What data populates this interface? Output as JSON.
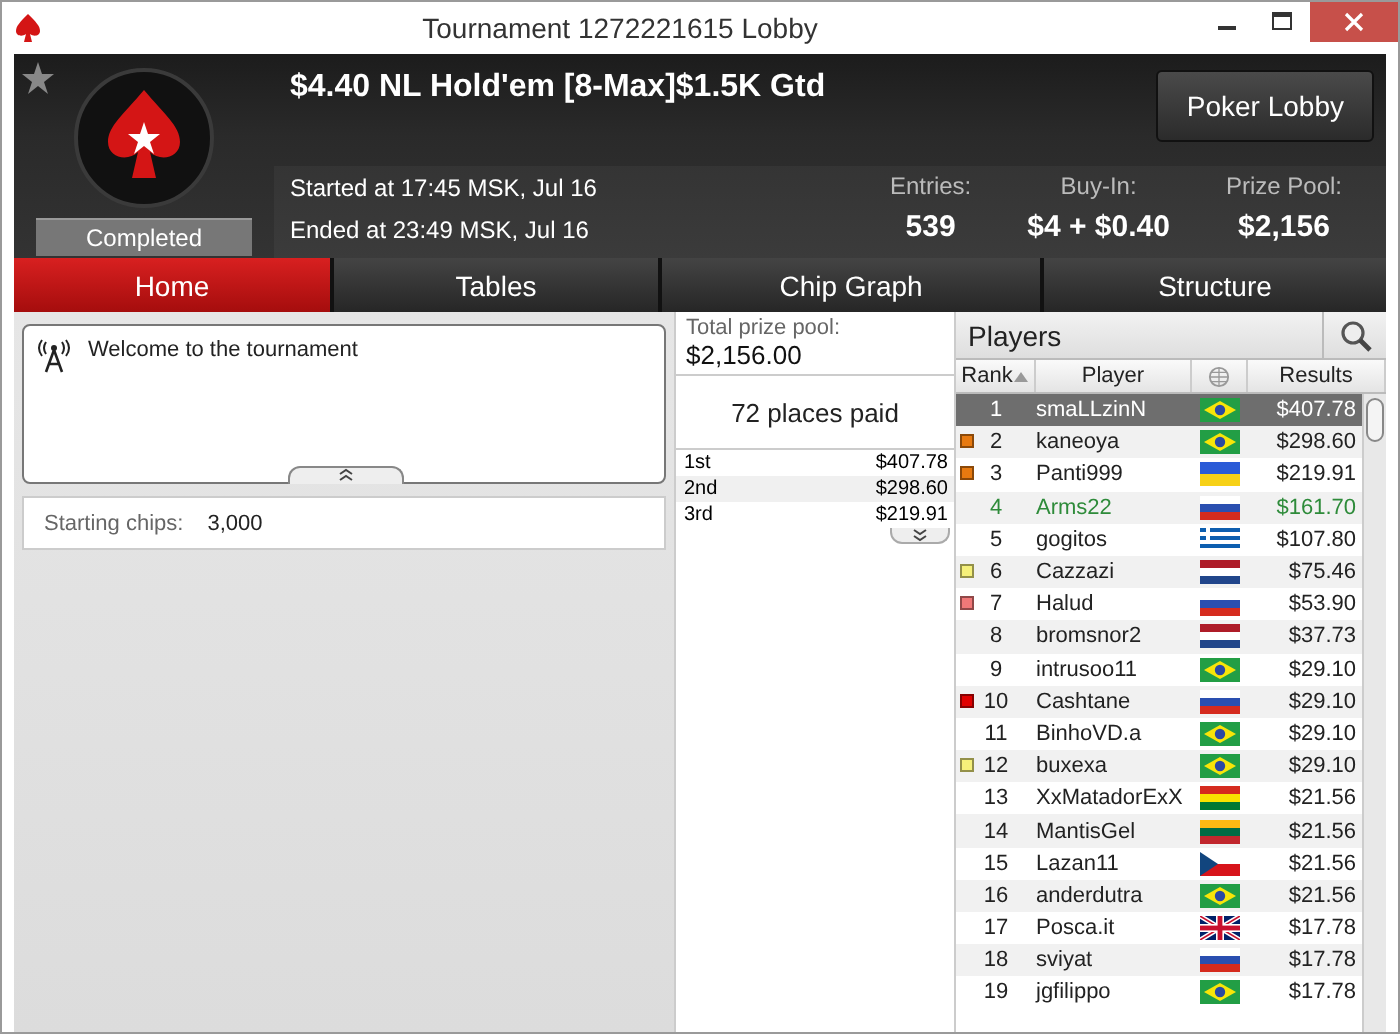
{
  "window": {
    "title": "Tournament 1272221615 Lobby"
  },
  "header": {
    "tournament_name": "$4.40 NL Hold'em [8-Max]$1.5K Gtd",
    "status": "Completed",
    "started": "Started at 17:45 MSK, Jul 16",
    "ended": "Ended at 23:49 MSK, Jul 16",
    "lobby_button": "Poker Lobby",
    "stats": [
      {
        "label": "Entries:",
        "value": "539"
      },
      {
        "label": "Buy-In:",
        "value": "$4 + $0.40"
      },
      {
        "label": "Prize Pool:",
        "value": "$2,156"
      }
    ]
  },
  "tabs": [
    {
      "label": "Home",
      "selected": true
    },
    {
      "label": "Tables",
      "selected": false
    },
    {
      "label": "Chip Graph",
      "selected": false
    },
    {
      "label": "Structure",
      "selected": false
    }
  ],
  "news": {
    "message": "Welcome to the tournament"
  },
  "info": {
    "label": "Starting chips:",
    "value": "3,000"
  },
  "prizes": {
    "total_label": "Total prize pool:",
    "total": "$2,156.00",
    "places": "72 places paid",
    "rows": [
      {
        "place": "1st",
        "amount": "$407.78"
      },
      {
        "place": "2nd",
        "amount": "$298.60"
      },
      {
        "place": "3rd",
        "amount": "$219.91"
      }
    ]
  },
  "players": {
    "title": "Players",
    "columns": [
      "Rank",
      "Player",
      "Results"
    ],
    "rows": [
      {
        "rank": "1",
        "name": "smaLLzinN",
        "flag": {
          "kind": "br"
        },
        "result": "$407.78",
        "selected": true,
        "highlighted": false
      },
      {
        "rank": "2",
        "name": "kaneoya",
        "flag": {
          "kind": "br"
        },
        "result": "$298.60",
        "selected": false,
        "highlighted": false,
        "color": "#e87a10"
      },
      {
        "rank": "3",
        "name": "Panti999",
        "flag": {
          "kind": "ua"
        },
        "result": "$219.91",
        "selected": false,
        "highlighted": false,
        "color": "#e87a10"
      },
      {
        "rank": "4",
        "name": "Arms22",
        "flag": {
          "kind": "ru"
        },
        "result": "$161.70",
        "selected": false,
        "highlighted": true
      },
      {
        "rank": "5",
        "name": "gogitos",
        "flag": {
          "kind": "gr"
        },
        "result": "$107.80",
        "selected": false,
        "highlighted": false
      },
      {
        "rank": "6",
        "name": "Cazzazi",
        "flag": {
          "kind": "nl"
        },
        "result": "$75.46",
        "selected": false,
        "highlighted": false,
        "color": "#f5f07a"
      },
      {
        "rank": "7",
        "name": "Halud",
        "flag": {
          "kind": "ru"
        },
        "result": "$53.90",
        "selected": false,
        "highlighted": false,
        "color": "#f07878"
      },
      {
        "rank": "8",
        "name": "bromsnor2",
        "flag": {
          "kind": "nl"
        },
        "result": "$37.73",
        "selected": false,
        "highlighted": false
      },
      {
        "rank": "9",
        "name": "intrusoo11",
        "flag": {
          "kind": "br"
        },
        "result": "$29.10",
        "selected": false,
        "highlighted": false
      },
      {
        "rank": "10",
        "name": "Cashtane",
        "flag": {
          "kind": "ru"
        },
        "result": "$29.10",
        "selected": false,
        "highlighted": false,
        "color": "#e00000"
      },
      {
        "rank": "11",
        "name": "BinhoVD.a",
        "flag": {
          "kind": "br"
        },
        "result": "$29.10",
        "selected": false,
        "highlighted": false
      },
      {
        "rank": "12",
        "name": "buxexa",
        "flag": {
          "kind": "br"
        },
        "result": "$29.10",
        "selected": false,
        "highlighted": false,
        "color": "#f5f07a"
      },
      {
        "rank": "13",
        "name": "XxMatadorExX",
        "flag": {
          "kind": "bo"
        },
        "result": "$21.56",
        "selected": false,
        "highlighted": false
      },
      {
        "rank": "14",
        "name": "MantisGel",
        "flag": {
          "kind": "lt"
        },
        "result": "$21.56",
        "selected": false,
        "highlighted": false
      },
      {
        "rank": "15",
        "name": "Lazan11",
        "flag": {
          "kind": "cz"
        },
        "result": "$21.56",
        "selected": false,
        "highlighted": false
      },
      {
        "rank": "16",
        "name": "anderdutra",
        "flag": {
          "kind": "br"
        },
        "result": "$21.56",
        "selected": false,
        "highlighted": false
      },
      {
        "rank": "17",
        "name": "Posca.it",
        "flag": {
          "kind": "gb"
        },
        "result": "$17.78",
        "selected": false,
        "highlighted": false
      },
      {
        "rank": "18",
        "name": "sviyat",
        "flag": {
          "kind": "ru"
        },
        "result": "$17.78",
        "selected": false,
        "highlighted": false
      },
      {
        "rank": "19",
        "name": "jgfilippo",
        "flag": {
          "kind": "br"
        },
        "result": "$17.78",
        "selected": false,
        "highlighted": false
      }
    ]
  }
}
